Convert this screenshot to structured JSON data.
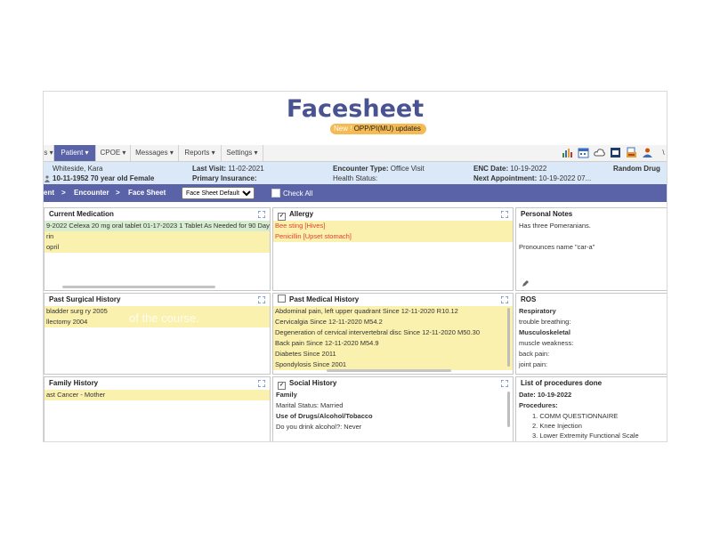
{
  "header": {
    "title": "Facesheet",
    "opp_tag": "New !",
    "opp_label": "OPP/PI(MU) updates"
  },
  "menu": {
    "items": [
      {
        "label": "s ▾"
      },
      {
        "label": "Patient ▾"
      },
      {
        "label": "CPOE ▾"
      },
      {
        "label": "Messages ▾"
      },
      {
        "label": "Reports ▾"
      },
      {
        "label": "Settings ▾"
      }
    ],
    "toolbar_icons": [
      "bar-chart-icon",
      "calendar-icon",
      "cloud-icon",
      "pdf-icon",
      "fax-icon",
      "user-icon"
    ],
    "toolbar_trailing": "\\"
  },
  "patient_info": {
    "name": "Whiteside, Kara",
    "dob_age": "10-11-1952 70 year old Female",
    "last_visit_label": "Last Visit:",
    "last_visit": "11-02-2021",
    "primary_insurance_label": "Primary Insurance:",
    "encounter_type_label": "Encounter Type:",
    "encounter_type": "Office Visit",
    "health_status_label": "Health Status:",
    "enc_date_label": "ENC Date:",
    "enc_date": "10-19-2022",
    "next_appt_label": "Next Appointment:",
    "next_appt": "10-19-2022 07...",
    "random_drug": "Random Drug"
  },
  "breadcrumb": {
    "item1": "ent",
    "sep1": ">",
    "item2": "Encounter",
    "sep2": ">",
    "item3": "Face Sheet",
    "select_value": "Face Sheet Default",
    "check_all": "Check All"
  },
  "panels": {
    "current_medication": {
      "title": "Current Medication",
      "rows": [
        "9-2022 Celexa 20 mg oral tablet 01-17-2023 1 Tablet As Needed for 90 Day",
        "rin",
        "opril"
      ]
    },
    "allergy": {
      "title": "Allergy",
      "rows": [
        "Bee sting [Hives]",
        "Penicillin [Upset stomach]"
      ]
    },
    "personal_notes": {
      "title": "Personal Notes",
      "lines": [
        "Has three Pomeranians.",
        "Pronounces name \"car-a\""
      ]
    },
    "past_surgical": {
      "title": "Past Surgical History",
      "rows": [
        "bladder surg ry 2005",
        "llectomy 2004"
      ]
    },
    "past_medical": {
      "title": "Past Medical History",
      "rows": [
        "Abdominal pain, left upper quadrant Since 12-11-2020 R10.12",
        "Cervicalgia Since 12-11-2020 M54.2",
        "Degeneration of cervical intervertebral disc Since 12-11-2020 M50.30",
        "Back pain Since 12-11-2020 M54.9",
        "Diabetes Since 2011",
        "Spondylosis Since 2001"
      ]
    },
    "ros": {
      "title": "ROS",
      "lines": [
        {
          "text": "Respiratory",
          "bold": true
        },
        {
          "text": "trouble breathing:",
          "bold": false
        },
        {
          "text": "Musculoskeletal",
          "bold": true
        },
        {
          "text": "muscle weakness:",
          "bold": false
        },
        {
          "text": "back pain:",
          "bold": false
        },
        {
          "text": "joint pain:",
          "bold": false
        }
      ]
    },
    "family_history": {
      "title": "Family History",
      "rows": [
        "ast Cancer - Mother"
      ]
    },
    "social_history": {
      "title": "Social History",
      "lines": [
        {
          "text": "Family",
          "bold": true
        },
        {
          "text": "Marital Status: Married",
          "bold": false
        },
        {
          "text": "Use of Drugs/Alcohol/Tobacco",
          "bold": true
        },
        {
          "text": "Do you drink alcohol?: Never",
          "bold": false
        }
      ]
    },
    "procedures": {
      "title": "List of procedures done",
      "date": "Date: 10-19-2022",
      "procedures_label": "Procedures:",
      "items": [
        "1. COMM QUESTIONNAIRE",
        "2. Knee Injection",
        "3. Lower Extremity Functional Scale"
      ]
    }
  },
  "overlay_text": "of the course.",
  "colors": {
    "brand": "#4a5391",
    "nav": "#5a63a8",
    "info_bg": "#dbe8f7",
    "highlight_yellow": "#fbf1ae",
    "highlight_green": "#d8ecd0",
    "allergy_red": "#e0402d",
    "badge_orange": "#f6ba52"
  }
}
